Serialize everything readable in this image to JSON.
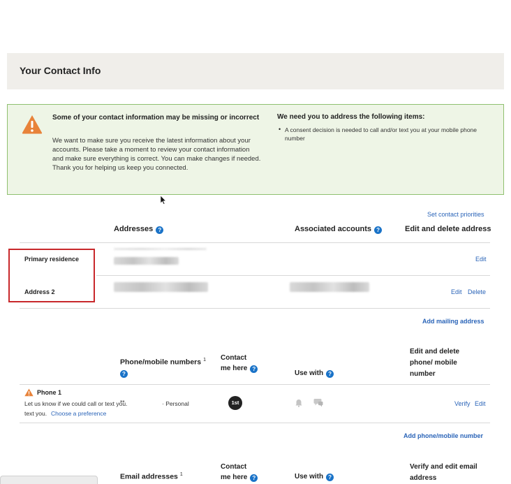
{
  "header": {
    "title": "Your Contact Info"
  },
  "alert": {
    "heading": "Some of your contact information may be missing or incorrect",
    "body": "We want to make sure you receive the latest information about your accounts. Please take a moment to review your contact information and make sure everything is correct. You can make changes if needed. Thank you for helping us keep you connected.",
    "right_heading": "We need you to address the following items:",
    "items": [
      "A consent decision is needed to call and/or text you at your mobile phone number"
    ]
  },
  "links": {
    "set_priorities": "Set contact priorities",
    "add_mailing": "Add mailing address",
    "add_phone": "Add phone/mobile number"
  },
  "addresses": {
    "col_addresses": "Addresses",
    "col_accounts": "Associated accounts",
    "col_edit": "Edit and delete address",
    "rows": [
      {
        "label": "Primary residence",
        "edit": "Edit"
      },
      {
        "label": "Address 2",
        "edit": "Edit",
        "delete": "Delete"
      }
    ]
  },
  "phones": {
    "col_numbers": "Phone/mobile numbers",
    "col_numbers_sup": "1",
    "col_contact_line1": "Contact",
    "col_contact_line2": "me here",
    "col_use": "Use with",
    "col_edit_line1": "Edit and delete",
    "col_edit_line2": "phone/ mobile",
    "col_edit_line3": "number",
    "rows": [
      {
        "label": "Phone 1",
        "note": "Let us know if we could call or text you.",
        "note_link": "Choose a preference",
        "number": "**",
        "type": "· Personal",
        "priority": "1st",
        "verify": "Verify",
        "edit": "Edit"
      }
    ]
  },
  "emails": {
    "col_addresses": "Email addresses",
    "col_addresses_sup": "1",
    "col_contact_line1": "Contact",
    "col_contact_line2": "me here",
    "col_use": "Use with",
    "col_edit_line1": "Verify and edit email",
    "col_edit_line2": "address"
  },
  "icons": {
    "alert": "warning-triangle-icon",
    "help": "question-circle-icon",
    "bell": "bell-icon",
    "chat": "chat-icon",
    "cursor": "mouse-pointer-icon"
  },
  "colors": {
    "alert_bg": "#eef5e6",
    "alert_border": "#8fc06f",
    "warning": "#e8833a",
    "link": "#2a64b8",
    "help": "#1a73c8",
    "highlight_box": "#c8282b"
  }
}
